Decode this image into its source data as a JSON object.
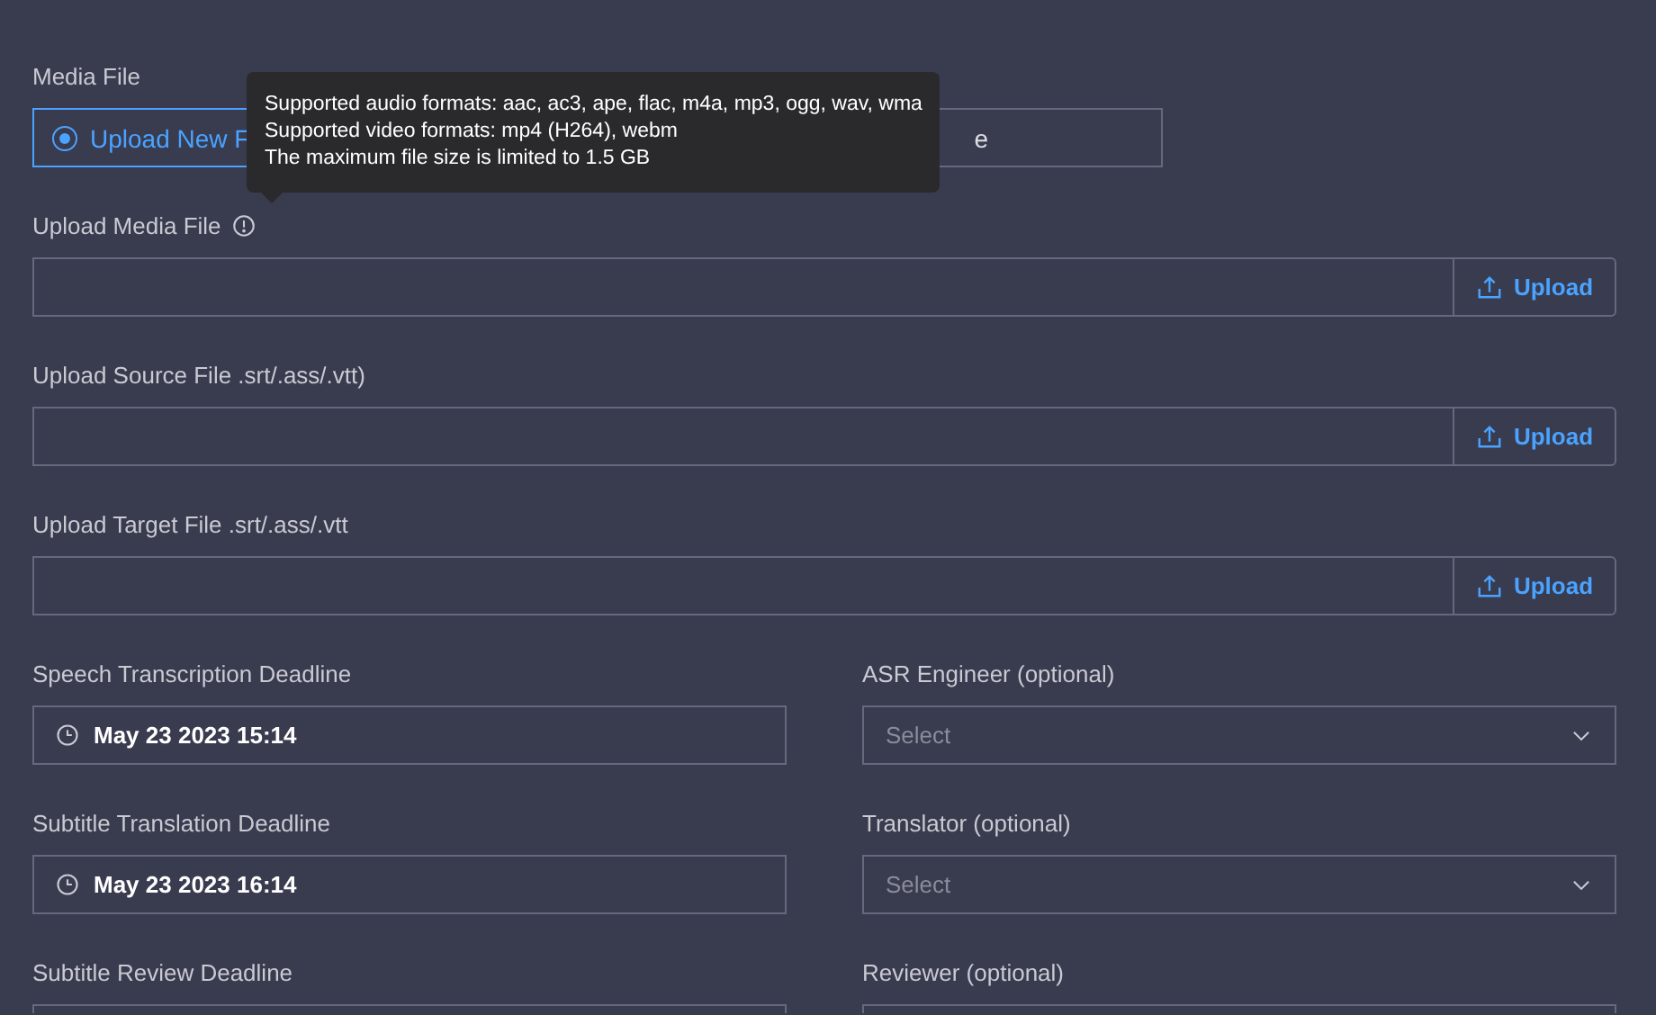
{
  "media_file": {
    "label": "Media File",
    "options": [
      {
        "label": "Upload New F",
        "selected": true
      },
      {
        "label": "e",
        "selected": false
      }
    ]
  },
  "tooltip": {
    "lines": [
      "Supported audio formats: aac, ac3, ape, flac, m4a, mp3, ogg, wav, wma",
      "Supported video formats: mp4 (H264), webm",
      "The maximum file size is limited to 1.5 GB"
    ]
  },
  "uploads": [
    {
      "label": "Upload Media File",
      "info": true,
      "button": "Upload"
    },
    {
      "label": "Upload Source File .srt/.ass/.vtt)",
      "info": false,
      "button": "Upload"
    },
    {
      "label": "Upload Target File .srt/.ass/.vtt",
      "info": false,
      "button": "Upload"
    }
  ],
  "rows": [
    {
      "deadline": {
        "label": "Speech Transcription Deadline",
        "value": "May 23 2023 15:14"
      },
      "assignee": {
        "label": "ASR Engineer (optional)",
        "placeholder": "Select"
      }
    },
    {
      "deadline": {
        "label": "Subtitle Translation Deadline",
        "value": "May 23 2023 16:14"
      },
      "assignee": {
        "label": "Translator (optional)",
        "placeholder": "Select"
      }
    },
    {
      "deadline": {
        "label": "Subtitle Review Deadline"
      },
      "assignee": {
        "label": "Reviewer (optional)"
      }
    }
  ]
}
